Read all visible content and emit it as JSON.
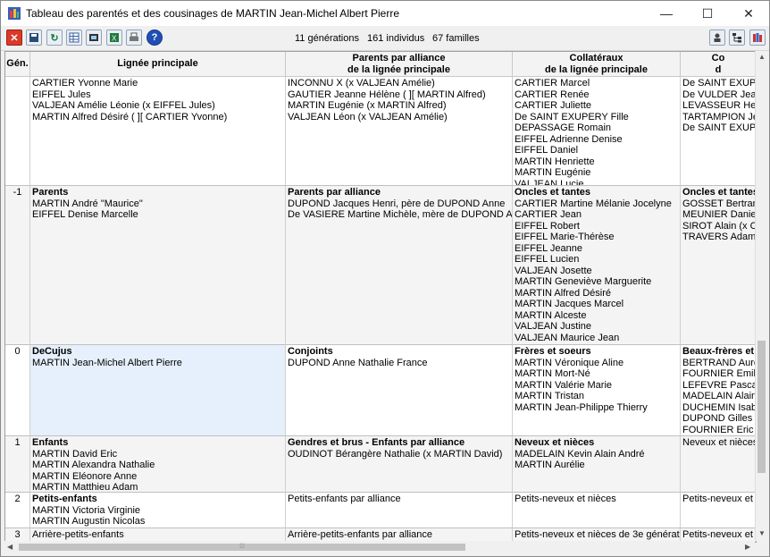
{
  "title": "Tableau des parentés et des cousinages de  MARTIN Jean-Michel Albert Pierre",
  "window_controls": {
    "minimize": "—",
    "maximize": "☐",
    "close": "✕"
  },
  "toolbar": {
    "stats": {
      "generations": "11 générations",
      "individus": "161 individus",
      "familles": "67 familles"
    },
    "icons": [
      "close-icon",
      "save-icon",
      "refresh-icon",
      "grid-icon",
      "film-icon",
      "excel-icon",
      "print-icon",
      "help-icon",
      "person-icon",
      "tree-icon",
      "family-icon"
    ]
  },
  "columns": {
    "gen": "Gén.",
    "main": "Lignée principale",
    "alliance": [
      "Parents par alliance",
      "de la lignée principale"
    ],
    "collateral": [
      "Collatéraux",
      "de la lignée principale"
    ],
    "extra": [
      "Co",
      "d"
    ]
  },
  "rows": [
    {
      "gen": "",
      "main": {
        "header": "",
        "items": [
          "CARTIER Yvonne Marie",
          "EIFFEL Jules",
          "VALJEAN Amélie Léonie (x EIFFEL Jules)",
          "MARTIN Alfred Désiré ( ][ CARTIER Yvonne)"
        ]
      },
      "alliance": {
        "header": "",
        "items": [
          "INCONNU X (x VALJEAN Amélie)",
          "GAUTIER Jeanne Hélène ( ][ MARTIN Alfred)",
          "MARTIN Eugénie (x MARTIN Alfred)",
          "VALJEAN Léon (x VALJEAN Amélie)"
        ]
      },
      "collateral": {
        "header": "",
        "items": [
          "CARTIER Marcel",
          "CARTIER Renée",
          "CARTIER Juliette",
          "De SAINT EXUPERY Fille",
          "DEPASSAGE Romain",
          "EIFFEL Adrienne Denise",
          "EIFFEL Daniel",
          "MARTIN Henriette",
          "MARTIN Eugénie",
          "VALJEAN Lucie"
        ]
      },
      "extra": {
        "header": "",
        "items": [
          "De SAINT EXUPERY",
          "De VULDER Jean (",
          "LEVASSEUR Henri",
          "TARTAMPION Jea",
          "De SAINT EXUPER"
        ]
      }
    },
    {
      "gen": "-1",
      "main": {
        "header": "Parents",
        "items": [
          "MARTIN André \"Maurice\"",
          "EIFFEL Denise Marcelle"
        ]
      },
      "alliance": {
        "header": "Parents par alliance",
        "items": [
          "DUPOND Jacques Henri, père de DUPOND Anne",
          "De VASIERE Martine Michèle, mère de DUPOND Anne"
        ]
      },
      "collateral": {
        "header": "Oncles et tantes",
        "items": [
          "CARTIER Martine Mélanie Jocelyne",
          "CARTIER Jean",
          "EIFFEL Robert",
          "EIFFEL Marie-Thérèse",
          "EIFFEL Jeanne",
          "EIFFEL Lucien",
          "VALJEAN Josette",
          "MARTIN Geneviève Marguerite",
          "MARTIN Alfred Désiré",
          "MARTIN Jacques Marcel",
          "MARTIN Alceste",
          "VALJEAN Justine",
          "VALJEAN Maurice Jean"
        ]
      },
      "extra": {
        "header": "Oncles et tantes",
        "items": [
          "GOSSET Bertrand",
          "MEUNIER Danielle J",
          "SIROT Alain (x CA",
          "TRAVERS Adam (x"
        ]
      }
    },
    {
      "gen": "0",
      "main": {
        "header": "DeCujus",
        "items": [
          "MARTIN Jean-Michel Albert Pierre"
        ]
      },
      "alliance": {
        "header": "Conjoints",
        "items": [
          "DUPOND Anne Nathalie France"
        ]
      },
      "collateral": {
        "header": "Frères et soeurs",
        "items": [
          "MARTIN Véronique Aline",
          "MARTIN Mort-Né",
          "MARTIN Valérie Marie",
          "MARTIN Tristan",
          "MARTIN Jean-Philippe Thierry"
        ]
      },
      "extra": {
        "header": "Beaux-frères et",
        "items": [
          "BERTRAND Auréli",
          "FOURNIER Emilie (x",
          "LEFEVRE Pascal (x",
          "MADELAIN Alain S",
          "DUCHEMIN Isabell",
          "DUPOND Gilles Her",
          "FOURNIER Eric (x D"
        ]
      }
    },
    {
      "gen": "1",
      "main": {
        "header": "Enfants",
        "items": [
          "MARTIN David Eric",
          "MARTIN Alexandra Nathalie",
          "MARTIN Eléonore Anne",
          "MARTIN Matthieu Adam"
        ]
      },
      "alliance": {
        "header": "Gendres et brus - Enfants par alliance",
        "items": [
          "OUDINOT Bérangère Nathalie (x MARTIN David)"
        ]
      },
      "collateral": {
        "header": "Neveux et nièces",
        "items": [
          "MADELAIN Kevin Alain André",
          "MARTIN Aurélie"
        ]
      },
      "extra": {
        "header": "",
        "items": [
          "Neveux et nièces p"
        ]
      }
    },
    {
      "gen": "2",
      "main": {
        "header": "Petits-enfants",
        "items": [
          "MARTIN Victoria Virginie",
          "MARTIN Augustin Nicolas"
        ]
      },
      "alliance": {
        "header": "",
        "items": [
          "Petits-enfants par alliance"
        ]
      },
      "collateral": {
        "header": "",
        "items": [
          "Petits-neveux et nièces"
        ]
      },
      "extra": {
        "header": "",
        "items": [
          "Petits-neveux et ni"
        ]
      }
    },
    {
      "gen": "3",
      "main": {
        "header": "",
        "items": [
          "Arrière-petits-enfants"
        ]
      },
      "alliance": {
        "header": "",
        "items": [
          "Arrière-petits-enfants par alliance"
        ]
      },
      "collateral": {
        "header": "",
        "items": [
          "Petits-neveux et nièces de 3e génération"
        ]
      },
      "extra": {
        "header": "",
        "items": [
          "Petits-neveux et ni"
        ]
      }
    }
  ],
  "scroll": {
    "grip": "⁞⁞⁞"
  }
}
